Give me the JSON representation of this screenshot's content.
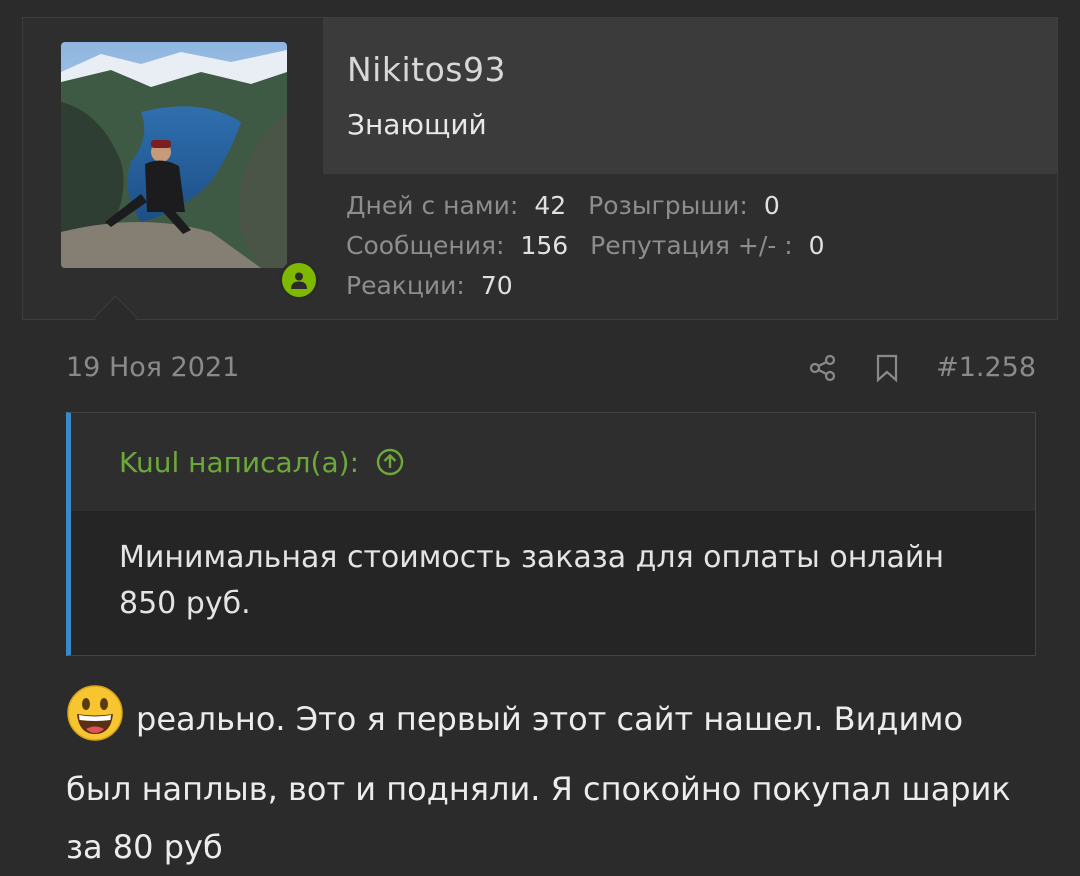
{
  "user": {
    "username": "Nikitos93",
    "title": "Знающий",
    "stats": {
      "days_label": "Дней с нами:",
      "days_value": "42",
      "giveaways_label": "Розыгрыши:",
      "giveaways_value": "0",
      "messages_label": "Сообщения:",
      "messages_value": "156",
      "reputation_label": "Репутация +/- :",
      "reputation_value": "0",
      "reactions_label": "Реакции:",
      "reactions_value": "70"
    },
    "online_color": "#7fb800"
  },
  "post": {
    "date": "19 Ноя 2021",
    "number": "#1.258",
    "icons": [
      "share-icon",
      "bookmark-icon"
    ],
    "quote": {
      "author": "Kuul написал(а):",
      "text": "Минимальная стоимость заказа для оплаты онлайн 850 руб."
    },
    "message_text": "реально. Это я первый этот сайт нашел. Видимо был наплыв, вот и подняли. Я спокойно покупал шарик за 80 руб",
    "emoji": "grinning-face-emoji"
  },
  "colors": {
    "background": "#2b2b2b",
    "quote_accent": "#3a8ac8",
    "quote_author": "#6ca83a"
  }
}
